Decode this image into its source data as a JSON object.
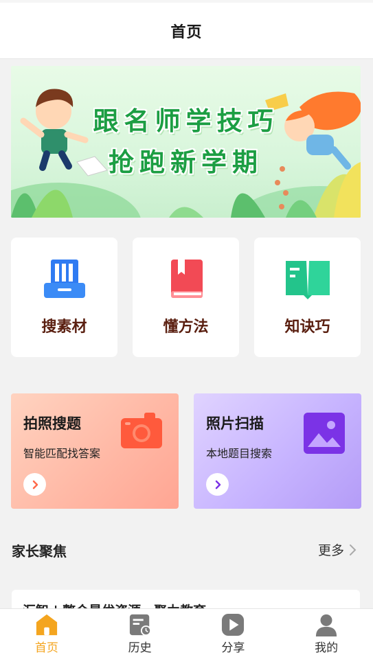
{
  "header": {
    "title": "首页"
  },
  "banner": {
    "line1": "跟名师学技巧",
    "line2": "抢跑新学期"
  },
  "categories": [
    {
      "label": "搜素材",
      "icon": "document-stack-icon",
      "color": "#2f7bf2"
    },
    {
      "label": "懂方法",
      "icon": "book-icon",
      "color": "#f24a55"
    },
    {
      "label": "知诀巧",
      "icon": "open-book-icon",
      "color": "#23c48b"
    }
  ],
  "cards": [
    {
      "title": "拍照搜题",
      "subtitle": "智能匹配找答案",
      "icon": "camera-icon",
      "color": "#ff5a3c"
    },
    {
      "title": "照片扫描",
      "subtitle": "本地题目搜索",
      "icon": "image-icon",
      "color": "#7b33e6"
    }
  ],
  "section": {
    "title": "家长聚焦",
    "more": "更多"
  },
  "articles": [
    {
      "title": "汇智 | 整合最优资源，聚力教育"
    }
  ],
  "tabbar": {
    "active_color": "#f4a51f",
    "items": [
      {
        "label": "首页",
        "icon": "home-icon"
      },
      {
        "label": "历史",
        "icon": "history-icon"
      },
      {
        "label": "分享",
        "icon": "play-share-icon"
      },
      {
        "label": "我的",
        "icon": "user-icon"
      }
    ]
  }
}
